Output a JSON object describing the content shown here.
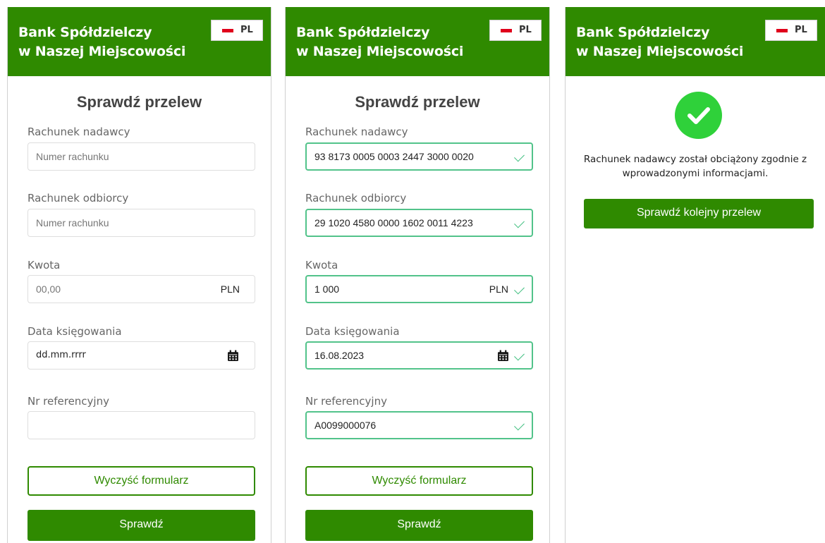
{
  "bank_name_line1": "Bank Spółdzielczy",
  "bank_name_line2": "w Naszej Miejscowości",
  "language": "PL",
  "form_title": "Sprawdź przelew",
  "labels": {
    "sender_account": "Rachunek nadawcy",
    "recipient_account": "Rachunek odbiorcy",
    "amount": "Kwota",
    "booking_date": "Data księgowania",
    "reference": "Nr referencyjny"
  },
  "placeholders": {
    "account": "Numer rachunku",
    "amount": "00,00",
    "date": "dd.mm.rrrr"
  },
  "currency": "PLN",
  "filled_form": {
    "sender_account": "93 8173 0005 0003 2447 3000 0020",
    "recipient_account": "29 1020 4580 0000 1602 0011 4223",
    "amount": "1 000",
    "booking_date": "16.08.2023",
    "reference": "A0099000076"
  },
  "buttons": {
    "clear": "Wyczyść formularz",
    "check": "Sprawdź",
    "check_next": "Sprawdź kolejny przelew"
  },
  "success_message": "Rachunek nadawcy został obciążony zgodnie z wprowadzonymi informacjami.",
  "colors": {
    "brand_green": "#2f8a00",
    "success_green": "#2fd13a",
    "valid_border": "#52c38a",
    "flag_red": "#e0001b"
  },
  "icons": [
    "calendar-icon",
    "check-icon",
    "success-check-icon",
    "flag-icon"
  ]
}
